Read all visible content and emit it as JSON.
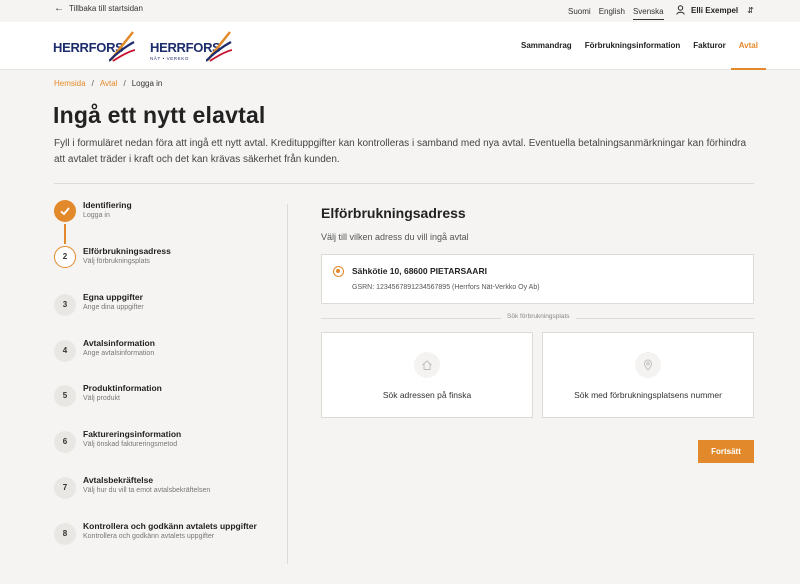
{
  "topbar": {
    "back_label": "Tillbaka till startsidan",
    "languages": [
      "Suomi",
      "English",
      "Svenska"
    ],
    "active_language": "Svenska",
    "user_name": "Elli Exempel"
  },
  "logos": {
    "left": "HERRFORS",
    "right": "HERRFORS",
    "right_sub": "NÄT • VERKKO"
  },
  "nav": {
    "items": [
      "Sammandrag",
      "Förbrukningsinformation",
      "Fakturor",
      "Avtal"
    ],
    "active": "Avtal"
  },
  "breadcrumb": [
    "Hemsida",
    "Avtal",
    "Logga in"
  ],
  "page": {
    "title": "Ingå ett nytt elavtal",
    "intro": "Fyll i formuläret nedan föra att ingå ett nytt avtal. Kredituppgifter kan kontrolleras i samband med nya avtal. Eventuella betalningsanmärkningar kan förhindra att avtalet träder i kraft och det kan krävas säkerhet från kunden."
  },
  "steps": [
    {
      "number": "1",
      "title": "Identifiering",
      "subtitle": "Logga in",
      "state": "done"
    },
    {
      "number": "2",
      "title": "Elförbrukningsadress",
      "subtitle": "Välj förbrukningsplats",
      "state": "current"
    },
    {
      "number": "3",
      "title": "Egna uppgifter",
      "subtitle": "Ange dina uppgifter",
      "state": "upcoming"
    },
    {
      "number": "4",
      "title": "Avtalsinformation",
      "subtitle": "Ange avtalsinformation",
      "state": "upcoming"
    },
    {
      "number": "5",
      "title": "Produktinformation",
      "subtitle": "Välj produkt",
      "state": "upcoming"
    },
    {
      "number": "6",
      "title": "Faktureringsinformation",
      "subtitle": "Välj önskad faktureringsmetod",
      "state": "upcoming"
    },
    {
      "number": "7",
      "title": "Avtalsbekräftelse",
      "subtitle": "Välj hur du vill ta emot avtalsbekräftelsen",
      "state": "upcoming"
    },
    {
      "number": "8",
      "title": "Kontrollera och godkänn avtalets uppgifter",
      "subtitle": "Kontrollera och godkänn avtalets uppgifter",
      "state": "upcoming"
    }
  ],
  "section": {
    "title": "Elförbrukningsadress",
    "subtitle": "Välj till vilken adress du vill ingå avtal",
    "address": "Sähkötie 10, 68600 PIETARSAARI",
    "gsrn": "GSRN: 1234567891234567895 (Herrfors Nät-Verkko Oy Ab)",
    "divider_label": "Sök förbrukningsplats",
    "option_finnish": "Sök adressen på finska",
    "option_number": "Sök med förbrukningsplatsens nummer",
    "continue_label": "Fortsätt"
  },
  "colors": {
    "accent": "#e28a2b",
    "brand_blue": "#1d2c6b",
    "background": "#f5f4f2"
  }
}
